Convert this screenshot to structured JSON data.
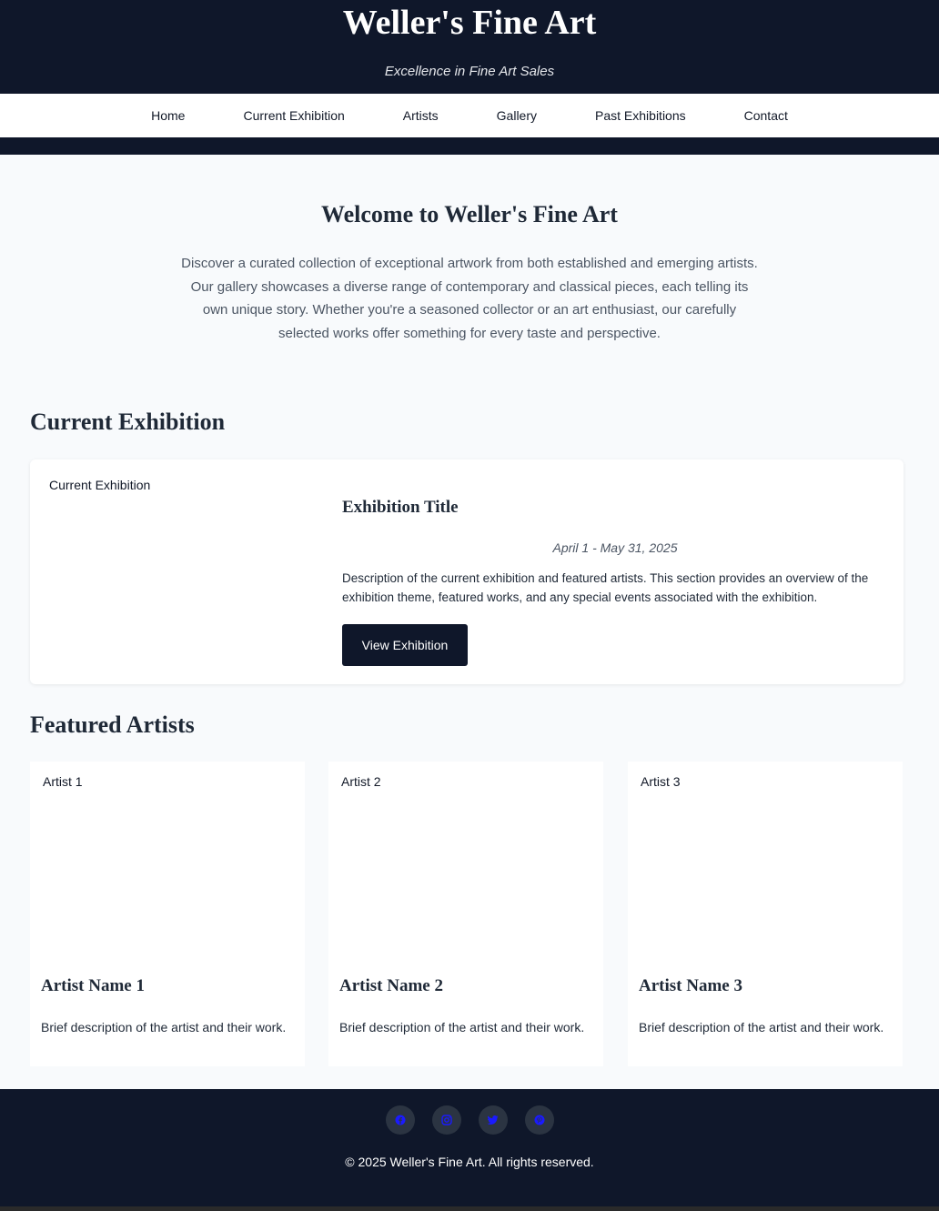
{
  "header": {
    "title": "Weller's Fine Art",
    "tagline": "Excellence in Fine Art Sales"
  },
  "nav": {
    "items": [
      {
        "label": "Home"
      },
      {
        "label": "Current Exhibition"
      },
      {
        "label": "Artists"
      },
      {
        "label": "Gallery"
      },
      {
        "label": "Past Exhibitions"
      },
      {
        "label": "Contact"
      }
    ]
  },
  "intro": {
    "title": "Welcome to Weller's Fine Art",
    "text": "Discover a curated collection of exceptional artwork from both established and emerging artists. Our gallery showcases a diverse range of contemporary and classical pieces, each telling its own unique story. Whether you're a seasoned collector or an art enthusiast, our carefully selected works offer something for every taste and perspective."
  },
  "current_exhibition": {
    "section_title": "Current Exhibition",
    "image_alt": "Current Exhibition",
    "title": "Exhibition Title",
    "dates": "April 1 - May 31, 2025",
    "description": "Description of the current exhibition and featured artists. This section provides an overview of the exhibition theme, featured works, and any special events associated with the exhibition.",
    "button_label": "View Exhibition"
  },
  "featured_artists": {
    "section_title": "Featured Artists",
    "artists": [
      {
        "image_alt": "Artist 1",
        "name": "Artist Name 1",
        "description": "Brief description of the artist and their work."
      },
      {
        "image_alt": "Artist 2",
        "name": "Artist Name 2",
        "description": "Brief description of the artist and their work."
      },
      {
        "image_alt": "Artist 3",
        "name": "Artist Name 3",
        "description": "Brief description of the artist and their work."
      }
    ]
  },
  "footer": {
    "social_icons": [
      "facebook-icon",
      "instagram-icon",
      "twitter-icon",
      "pinterest-icon"
    ],
    "copyright": "© 2025 Weller's Fine Art. All rights reserved."
  },
  "colors": {
    "header_bg": "#0f172a",
    "page_bg": "#f8fafc",
    "social_icon": "#1a1aff"
  }
}
